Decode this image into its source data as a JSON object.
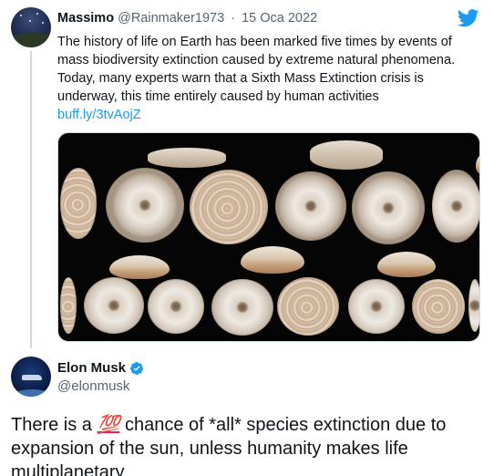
{
  "quoted_tweet": {
    "display_name": "Massimo",
    "handle": "@Rainmaker1973",
    "separator": "·",
    "date": "15 Oca 2022",
    "text": "The history of life on Earth has been marked five times by events of mass biodiversity extinction caused by extreme natural phenomena. Today, many experts warn that a Sixth Mass Extinction crisis is underway, this time entirely caused by human activities",
    "link": "buff.ly/3tvAojZ",
    "brand_icon": "twitter-bird-icon",
    "brand_color": "#1d9bf0"
  },
  "reply_tweet": {
    "display_name": "Elon Musk",
    "verified_icon": "verified-badge-icon",
    "handle": "@elonmusk",
    "text_before": "There is a ",
    "emoji": "💯",
    "text_after": " chance of *all* species extinction due to expansion of the sun, unless humanity makes life multiplanetary"
  },
  "colors": {
    "link": "#1d9bf0",
    "secondary_text": "#536471",
    "primary_text": "#0f1419",
    "thread_line": "#cfd9de"
  }
}
